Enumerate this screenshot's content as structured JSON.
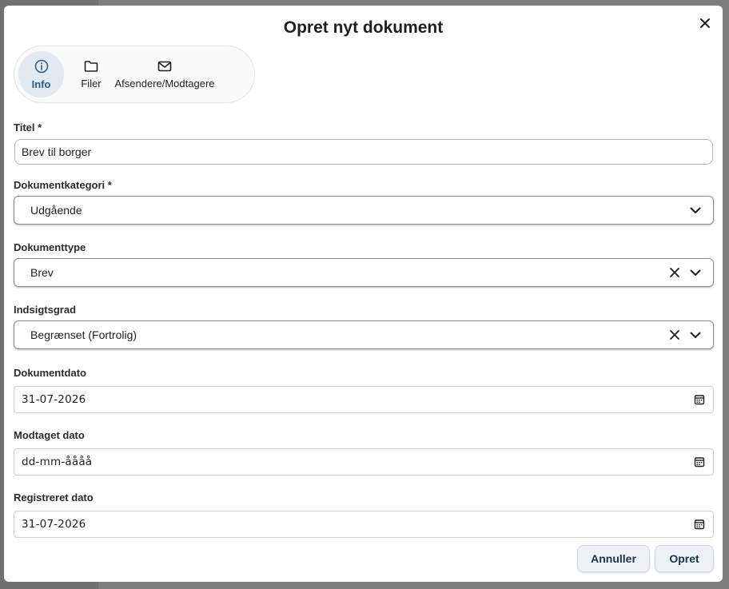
{
  "dialog": {
    "title": "Opret nyt dokument"
  },
  "tabs": [
    {
      "label": "Info",
      "icon": "info-icon",
      "active": true
    },
    {
      "label": "Filer",
      "icon": "folder-icon",
      "active": false
    },
    {
      "label": "Afsendere/Modtagere",
      "icon": "mail-icon",
      "active": false
    }
  ],
  "form": {
    "title": {
      "label": "Titel *",
      "value": "Brev til borger"
    },
    "category": {
      "label": "Dokumentkategori *",
      "value": "Udgående"
    },
    "doctype": {
      "label": "Dokumenttype",
      "value": "Brev"
    },
    "access": {
      "label": "Indsigtsgrad",
      "value": "Begrænset (Fortrolig)"
    },
    "doc_date": {
      "label": "Dokumentdato",
      "value": "31-07-2026"
    },
    "received_date": {
      "label": "Modtaget dato",
      "placeholder": "dd-mm-åååå"
    },
    "registered_date": {
      "label": "Registreret dato",
      "value": "31-07-2026"
    }
  },
  "actions": {
    "cancel": "Annuller",
    "create": "Opret"
  },
  "colors": {
    "accent": "#2a5b8c",
    "active_tab_bg": "#e2e9f1",
    "button_bg": "#eef2f6"
  }
}
